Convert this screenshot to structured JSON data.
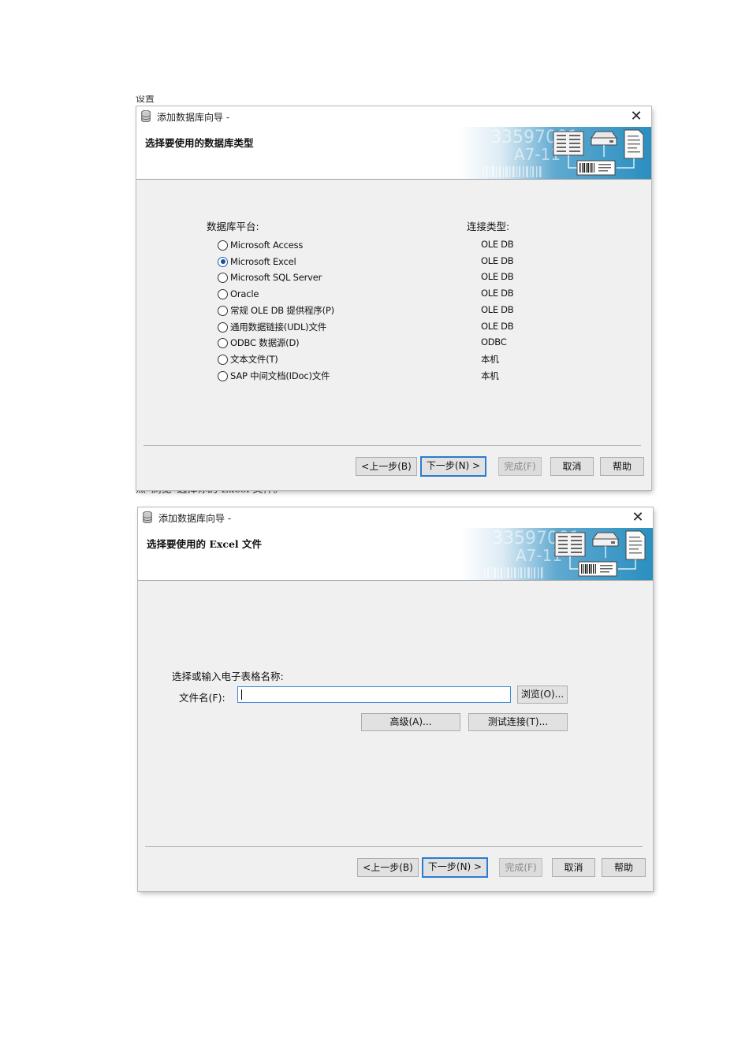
{
  "page": {
    "frag_top": "设置",
    "frag_between": "点“浏览”选择你的 Excel 文件。"
  },
  "dialog1": {
    "title": "添加数据库向导 -",
    "close_glyph": "✕",
    "header_title": "选择要使用的数据库类型",
    "banner_text_1": "33597001",
    "banner_text_2": "A7-11",
    "col_platform": "数据库平台:",
    "col_connection": "连接类型:",
    "options": [
      {
        "label": "Microsoft Access",
        "conn": "OLE DB",
        "checked": false
      },
      {
        "label": "Microsoft Excel",
        "conn": "OLE DB",
        "checked": true
      },
      {
        "label": "Microsoft SQL Server",
        "conn": "OLE DB",
        "checked": false
      },
      {
        "label": "Oracle",
        "conn": "OLE DB",
        "checked": false
      },
      {
        "label": "常规 OLE DB 提供程序(P)",
        "conn": "OLE DB",
        "checked": false
      },
      {
        "label": "通用数据链接(UDL)文件",
        "conn": "OLE DB",
        "checked": false
      },
      {
        "label": "ODBC 数据源(D)",
        "conn": "ODBC",
        "checked": false
      },
      {
        "label": "文本文件(T)",
        "conn": "本机",
        "checked": false
      },
      {
        "label": "SAP 中间文档(IDoc)文件",
        "conn": "本机",
        "checked": false
      }
    ],
    "buttons": {
      "back": "<上一步(B)",
      "next": "下一步(N) >",
      "finish": "完成(F)",
      "cancel": "取消",
      "help": "帮助"
    }
  },
  "dialog2": {
    "title": "添加数据库向导 -",
    "close_glyph": "✕",
    "header_title": "选择要使用的 Excel 文件",
    "banner_text_1": "33597001",
    "banner_text_2": "A7-11",
    "prompt": "选择或输入电子表格名称:",
    "file_label": "文件名(F):",
    "file_value": "",
    "browse": "浏览(O)...",
    "advanced": "高级(A)...",
    "test_connection": "测试连接(T)...",
    "buttons": {
      "back": "<上一步(B)",
      "next": "下一步(N) >",
      "finish": "完成(F)",
      "cancel": "取消",
      "help": "帮助"
    }
  },
  "colors": {
    "accent": "#2a7cd1",
    "banner_blue": "#2a8fc0",
    "body_bg": "#f0f0f0"
  }
}
